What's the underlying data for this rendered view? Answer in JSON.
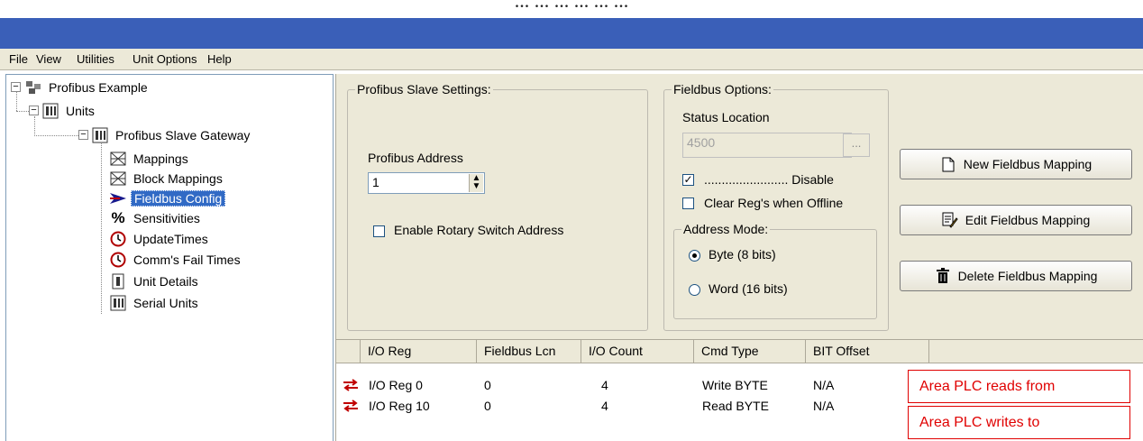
{
  "caption": "... ... ... ... ... ...",
  "menu": [
    {
      "label": "File"
    },
    {
      "label": "View"
    },
    {
      "label": "Utilities"
    },
    {
      "label": "Unit Options"
    },
    {
      "label": "Help"
    }
  ],
  "tree": {
    "root": "Profibus Example",
    "units": "Units",
    "gateway": "Profibus Slave Gateway",
    "children": [
      {
        "label": "Mappings",
        "icon": "mapping-icon"
      },
      {
        "label": "Block Mappings",
        "icon": "mapping-icon"
      },
      {
        "label": "Fieldbus Config",
        "icon": "arrow-icon",
        "selected": true
      },
      {
        "label": "Sensitivities",
        "icon": "percent-icon"
      },
      {
        "label": "UpdateTimes",
        "icon": "clock-icon"
      },
      {
        "label": "Comm's Fail Times",
        "icon": "clock-icon"
      },
      {
        "label": "Unit Details",
        "icon": "unit-icon"
      },
      {
        "label": "Serial Units",
        "icon": "unit-icon"
      }
    ]
  },
  "slave_settings": {
    "title": "Profibus Slave Settings:",
    "address_label": "Profibus Address",
    "address_value": "1",
    "rotary_label": "Enable Rotary Switch Address",
    "rotary_checked": false
  },
  "fieldbus_options": {
    "title": "Fieldbus Options:",
    "status_location_label": "Status Location",
    "status_location_value": "4500",
    "ellipsis": "...",
    "disable_label": "........................ Disable",
    "disable_checked": true,
    "clear_regs_label": "Clear Reg's when Offline",
    "clear_regs_checked": false,
    "address_mode": {
      "title": "Address Mode:",
      "byte_label": "Byte (8 bits)",
      "word_label": "Word (16 bits)",
      "selected": "byte"
    }
  },
  "buttons": {
    "new": "New Fieldbus Mapping",
    "edit": "Edit Fieldbus Mapping",
    "delete": "Delete Fieldbus Mapping"
  },
  "grid": {
    "columns": [
      "I/O Reg",
      "Fieldbus Lcn",
      "I/O Count",
      "Cmd Type",
      "BIT Offset"
    ],
    "rows": [
      {
        "reg": "I/O Reg 0",
        "lcn": "0",
        "count": "4",
        "cmd": "Write BYTE",
        "offset": "N/A"
      },
      {
        "reg": "I/O Reg 10",
        "lcn": "0",
        "count": "4",
        "cmd": "Read BYTE",
        "offset": "N/A"
      }
    ]
  },
  "annotations": {
    "reads": "Area PLC reads from",
    "writes": "Area PLC writes to"
  },
  "colors": {
    "titlebar": "#3a5fb8",
    "selection": "#316ac5",
    "annotation": "#e00000",
    "row_arrow": "#c00000"
  }
}
